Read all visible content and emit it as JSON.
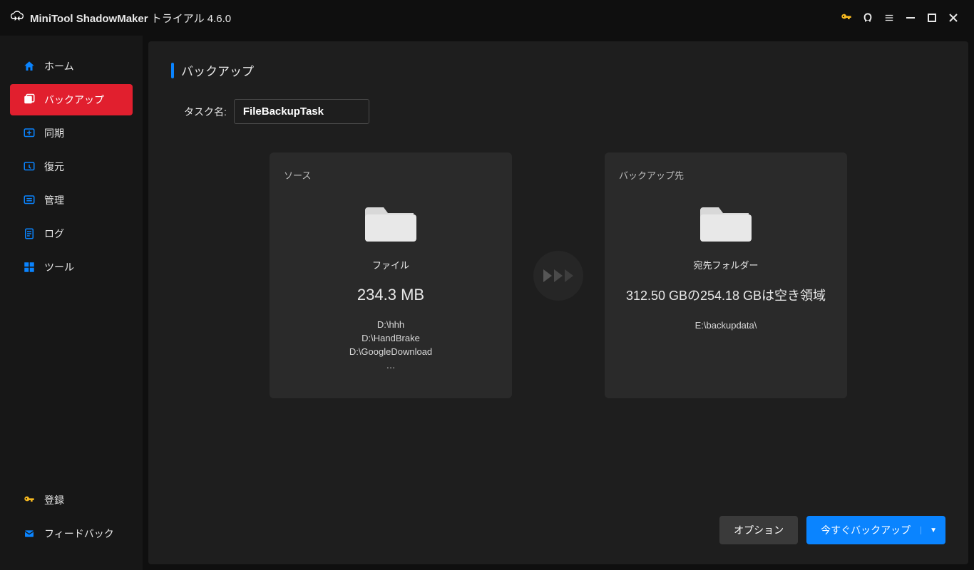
{
  "title": {
    "app": "MiniTool ShadowMaker",
    "suffix": "トライアル 4.6.0"
  },
  "sidebar": {
    "items": [
      {
        "label": "ホーム"
      },
      {
        "label": "バックアップ"
      },
      {
        "label": "同期"
      },
      {
        "label": "復元"
      },
      {
        "label": "管理"
      },
      {
        "label": "ログ"
      },
      {
        "label": "ツール"
      }
    ],
    "bottom": [
      {
        "label": "登録"
      },
      {
        "label": "フィードバック"
      }
    ]
  },
  "page": {
    "heading": "バックアップ",
    "task_label": "タスク名:",
    "task_value": "FileBackupTask"
  },
  "source": {
    "card_title": "ソース",
    "label": "ファイル",
    "size": "234.3 MB",
    "paths": [
      "D:\\hhh",
      "D:\\HandBrake",
      "D:\\GoogleDownload",
      "…"
    ]
  },
  "destination": {
    "card_title": "バックアップ先",
    "label": "宛先フォルダー",
    "size_line": "312.50 GBの254.18 GBは空き領域",
    "path": "E:\\backupdata\\"
  },
  "footer": {
    "options": "オプション",
    "backup_now": "今すぐバックアップ"
  }
}
